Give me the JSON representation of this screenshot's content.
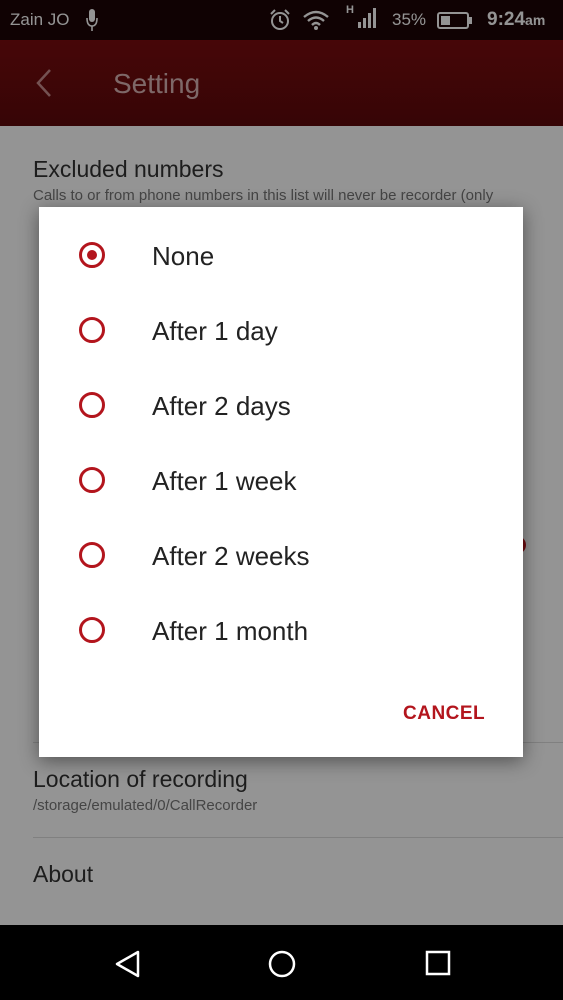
{
  "status_bar": {
    "carrier": "Zain JO",
    "network_type": "H",
    "battery_percent": "35%",
    "time": "9:24",
    "time_suffix": "am",
    "icons": [
      "mic-icon",
      "alarm-icon",
      "wifi-icon",
      "signal-icon",
      "battery-icon"
    ]
  },
  "app_bar": {
    "title": "Setting",
    "back_icon": "back-arrow-icon"
  },
  "settings_list": {
    "items": [
      {
        "title": "Excluded numbers",
        "subtitle": "Calls to or from phone numbers in this list will never be recorder (only"
      },
      {
        "title": "Location of recording",
        "subtitle": "/storage/emulated/0/CallRecorder"
      },
      {
        "title": "About",
        "subtitle": ""
      }
    ]
  },
  "dialog": {
    "options": [
      {
        "label": "None",
        "checked": true
      },
      {
        "label": "After 1 day",
        "checked": false
      },
      {
        "label": "After 2 days",
        "checked": false
      },
      {
        "label": "After 1 week",
        "checked": false
      },
      {
        "label": "After 2 weeks",
        "checked": false
      },
      {
        "label": "After 1 month",
        "checked": false
      }
    ],
    "cancel_label": "CANCEL"
  },
  "nav_bar": {
    "icons": [
      "back-triangle-icon",
      "home-circle-icon",
      "recents-square-icon"
    ]
  },
  "colors": {
    "accent": "#b3151d",
    "app_bar": "#7a0b0e",
    "status_bar": "#1c0506"
  }
}
